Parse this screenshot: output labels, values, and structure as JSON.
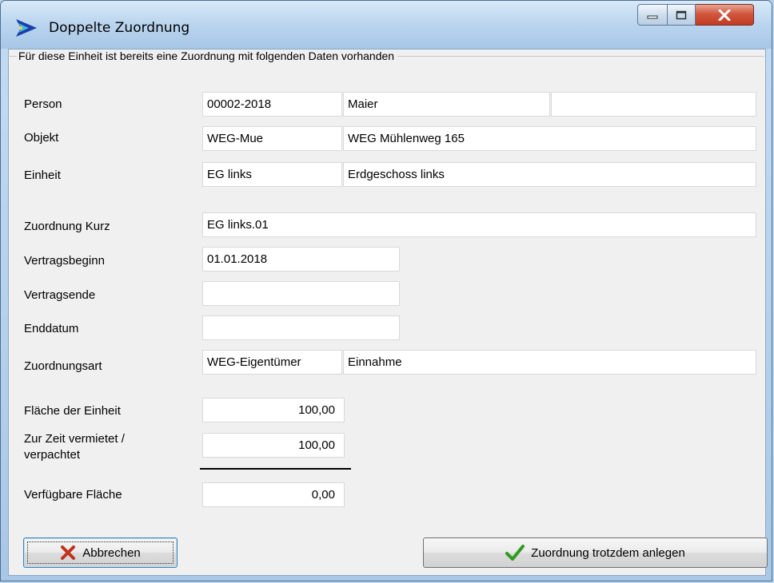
{
  "window": {
    "title": "Doppelte Zuordnung"
  },
  "group": {
    "caption": "Für diese Einheit ist bereits eine Zuordnung mit folgenden Daten vorhanden"
  },
  "person": {
    "label": "Person",
    "nr": "00002-2018",
    "name": "Maier",
    "extra": ""
  },
  "objekt": {
    "label": "Objekt",
    "code": "WEG-Mue",
    "name": "WEG Mühlenweg 165"
  },
  "einheit": {
    "label": "Einheit",
    "code": "EG links",
    "name": "Erdgeschoss links"
  },
  "zuordnung_kurz": {
    "label": "Zuordnung Kurz",
    "value": "EG links.01"
  },
  "vertragsbeginn": {
    "label": "Vertragsbeginn",
    "value": "01.01.2018"
  },
  "vertragsende": {
    "label": "Vertragsende",
    "value": ""
  },
  "enddatum": {
    "label": "Enddatum",
    "value": ""
  },
  "zuordnungsart": {
    "label": "Zuordnungsart",
    "code": "WEG-Eigentümer",
    "name": "Einnahme"
  },
  "flaeche_einheit": {
    "label": "Fläche der Einheit",
    "value": "100,00"
  },
  "vermietet": {
    "label_line1": "Zur Zeit vermietet /",
    "label_line2": "verpachtet",
    "value": "100,00"
  },
  "verfuegbar": {
    "label": "Verfügbare Fläche",
    "value": "0,00"
  },
  "buttons": {
    "cancel_label": "Abbrechen",
    "cancel_icon": "x-icon",
    "create_label": "Zuordnung trotzdem anlegen",
    "create_icon": "checkmark-icon"
  },
  "colors": {
    "cancel_icon": "#c0321c",
    "create_icon": "#2e9a1e",
    "close_button": "#c84a30"
  }
}
